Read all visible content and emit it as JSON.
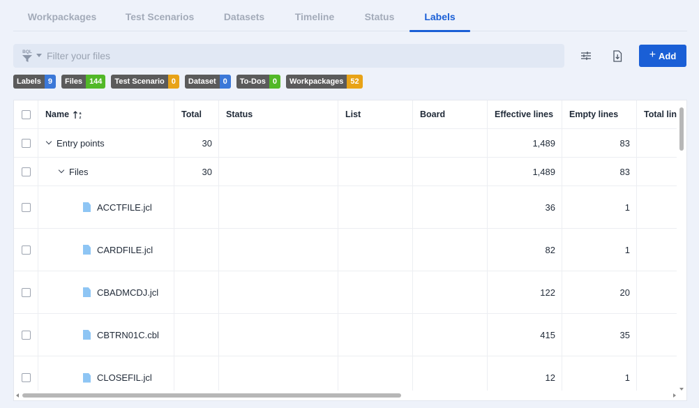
{
  "tabs": [
    {
      "label": "Workpackages",
      "active": false
    },
    {
      "label": "Test Scenarios",
      "active": false
    },
    {
      "label": "Datasets",
      "active": false
    },
    {
      "label": "Timeline",
      "active": false
    },
    {
      "label": "Status",
      "active": false
    },
    {
      "label": "Labels",
      "active": true
    }
  ],
  "search": {
    "placeholder": "Filter your files",
    "value": "",
    "icon_text": "BQL"
  },
  "toolbar": {
    "add_label": "Add"
  },
  "badges": [
    {
      "label": "Labels",
      "count": "9",
      "color": "#3b78d8"
    },
    {
      "label": "Files",
      "count": "144",
      "color": "#52b828"
    },
    {
      "label": "Test Scenario",
      "count": "0",
      "color": "#e8a317"
    },
    {
      "label": "Dataset",
      "count": "0",
      "color": "#3b78d8"
    },
    {
      "label": "To-Dos",
      "count": "0",
      "color": "#52b828"
    },
    {
      "label": "Workpackages",
      "count": "52",
      "color": "#e8a317"
    }
  ],
  "table": {
    "headers": {
      "name": "Name",
      "total": "Total",
      "status": "Status",
      "list": "List",
      "board": "Board",
      "effective": "Effective lines",
      "empty": "Empty lines",
      "total_lines": "Total lines"
    },
    "rows": [
      {
        "name": "Entry points",
        "kind": "group",
        "level": 0,
        "total": "30",
        "effective": "1,489",
        "empty": "83"
      },
      {
        "name": "Files",
        "kind": "group",
        "level": 1,
        "total": "30",
        "effective": "1,489",
        "empty": "83"
      },
      {
        "name": "ACCTFILE.jcl",
        "kind": "file",
        "level": 2,
        "total": "",
        "effective": "36",
        "empty": "1"
      },
      {
        "name": "CARDFILE.jcl",
        "kind": "file",
        "level": 2,
        "total": "",
        "effective": "82",
        "empty": "1"
      },
      {
        "name": "CBADMCDJ.jcl",
        "kind": "file",
        "level": 2,
        "total": "",
        "effective": "122",
        "empty": "20"
      },
      {
        "name": "CBTRN01C.cbl",
        "kind": "file",
        "level": 2,
        "total": "",
        "effective": "415",
        "empty": "35"
      },
      {
        "name": "CLOSEFIL.jcl",
        "kind": "file",
        "level": 2,
        "total": "",
        "effective": "12",
        "empty": "1"
      }
    ]
  },
  "colors": {
    "accent": "#1a5fd6",
    "file_icon": "#8ec5f4"
  }
}
